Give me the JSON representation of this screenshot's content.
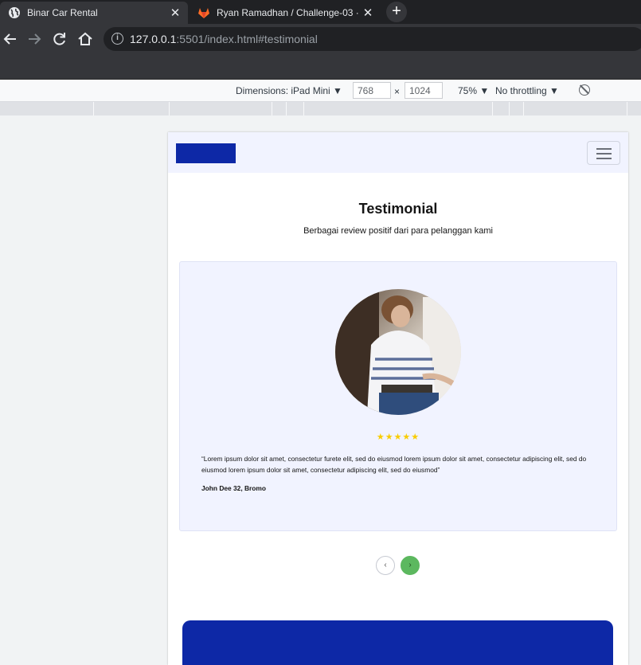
{
  "browser": {
    "tabs": [
      {
        "title": "Binar Car Rental",
        "active": true,
        "icon": "globe-icon"
      },
      {
        "title": "Ryan Ramadhan / Challenge-03 ·",
        "active": false,
        "icon": "gitlab-icon"
      }
    ],
    "close_glyph": "✕",
    "new_tab_glyph": "+",
    "url_host": "127.0.0.1",
    "url_rest": ":5501/index.html#testimonial"
  },
  "devtools": {
    "dimensions_label": "Dimensions: iPad Mini ▼",
    "width": "768",
    "times": "×",
    "height": "1024",
    "zoom": "75% ▼",
    "throttling": "No throttling ▼"
  },
  "page": {
    "testimonial": {
      "title": "Testimonial",
      "subtitle": "Berbagai review positif dari para pelanggan kami",
      "rating_stars": "★★★★★",
      "rating": 5,
      "quote": "“Lorem ipsum dolor sit amet, consectetur furete elit, sed do eiusmod lorem ipsum dolor sit amet, consectetur adipiscing elit, sed do eiusmod lorem ipsum dolor sit amet, consectetur adipiscing elit, sed do eiusmod”",
      "author": "John Dee 32, Bromo",
      "prev_glyph": "‹",
      "next_glyph": "›"
    }
  },
  "colors": {
    "brand_blue": "#0d28a6",
    "nav_bg": "#f1f3ff",
    "next_green": "#5cb85f",
    "star_yellow": "#f9cc00"
  }
}
